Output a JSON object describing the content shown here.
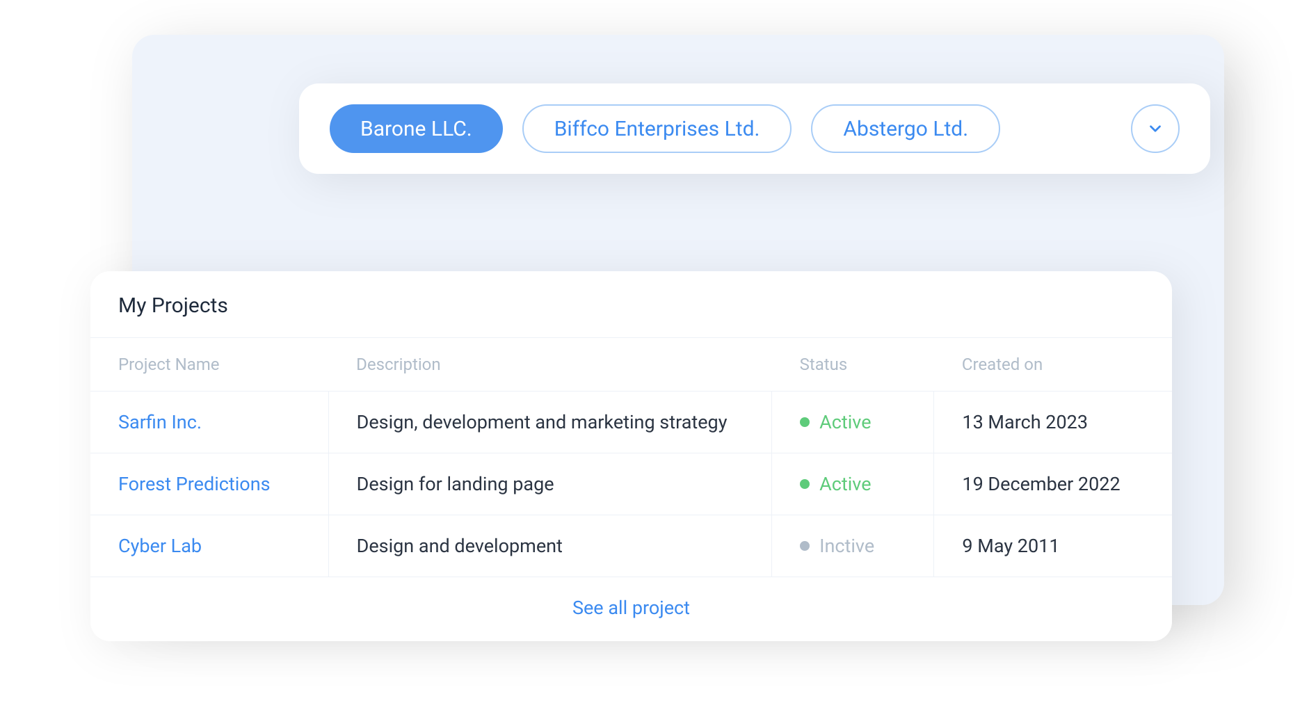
{
  "tabs": {
    "items": [
      {
        "label": "Barone LLC.",
        "active": true
      },
      {
        "label": "Biffco Enterprises Ltd.",
        "active": false
      },
      {
        "label": "Abstergo Ltd.",
        "active": false
      }
    ]
  },
  "projects": {
    "title": "My Projects",
    "columns": {
      "name": "Project Name",
      "description": "Description",
      "status": "Status",
      "created": "Created on"
    },
    "rows": [
      {
        "name": "Sarfin Inc.",
        "description": "Design, development and marketing strategy",
        "status_label": "Active",
        "status_kind": "active",
        "created": "13 March 2023"
      },
      {
        "name": "Forest Predictions",
        "description": "Design for landing page",
        "status_label": "Active",
        "status_kind": "active",
        "created": "19 December 2022"
      },
      {
        "name": "Cyber Lab",
        "description": "Design and development",
        "status_label": "Inctive",
        "status_kind": "inactive",
        "created": "9 May 2011"
      }
    ],
    "see_all": "See all project"
  }
}
